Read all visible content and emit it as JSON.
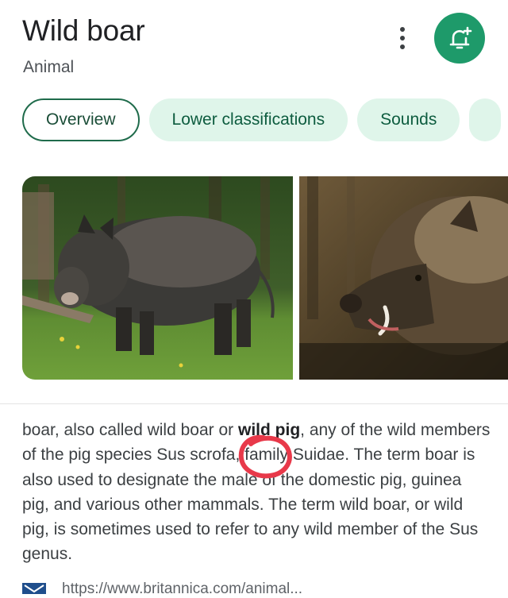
{
  "header": {
    "title": "Wild boar",
    "subtitle": "Animal"
  },
  "actions": {
    "more_icon": "more-vert-icon",
    "follow_icon": "bell-plus-icon",
    "follow_color": "#1e9a6a"
  },
  "tabs": [
    {
      "label": "Overview",
      "active": true
    },
    {
      "label": "Lower classifications",
      "active": false
    },
    {
      "label": "Sounds",
      "active": false
    }
  ],
  "images": [
    {
      "alt": "Wild boar standing on grass in a forest"
    },
    {
      "alt": "Close-up of a wild boar head with tusks"
    }
  ],
  "description": {
    "pre": "boar, also called wild boar or ",
    "bold": "wild pig",
    "mid": ", any of the wild members of the pig species ",
    "sci_a": "Sus",
    "sci_b": " scrofa, family Suidae. The term boar is also used to designate the male of the domestic pig, guinea pig, and various other mammals. The term wild boar, or wild pig, is sometimes used to refer to any wild member of the Sus genus."
  },
  "annotation": {
    "color": "#e8394a"
  },
  "source": {
    "url_partial": "https://www.britannica.com/animal..."
  }
}
